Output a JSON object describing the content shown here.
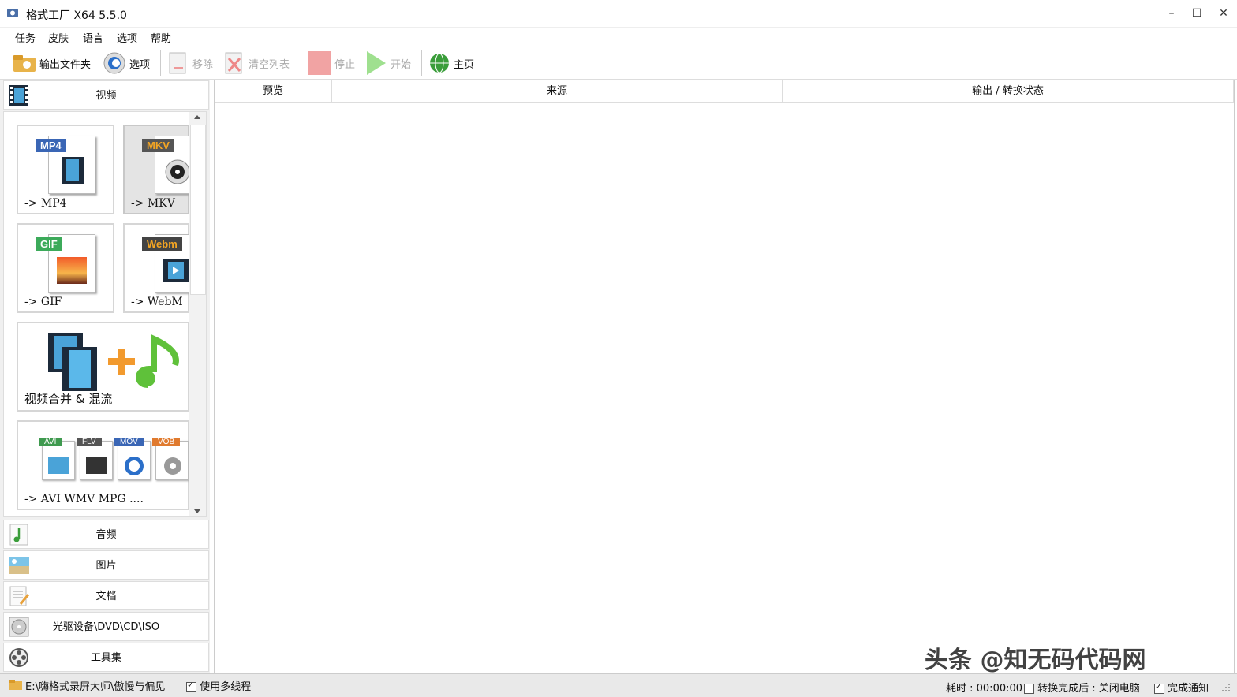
{
  "window": {
    "title": "格式工厂 X64 5.5.0",
    "min": "–",
    "max": "☐",
    "close": "✕"
  },
  "menu": [
    "任务",
    "皮肤",
    "语言",
    "选项",
    "帮助"
  ],
  "toolbar": {
    "output_folder": "输出文件夹",
    "options": "选项",
    "remove": "移除",
    "clear_list": "清空列表",
    "stop": "停止",
    "start": "开始",
    "home": "主页"
  },
  "categories": {
    "video": "视频",
    "audio": "音频",
    "image": "图片",
    "document": "文档",
    "optical": "光驱设备\\DVD\\CD\\ISO",
    "tools": "工具集"
  },
  "tiles": {
    "mp4": {
      "badge": "MP4",
      "caption": "-> MP4",
      "color": "#3a66b5"
    },
    "mkv": {
      "badge": "MKV",
      "caption": "-> MKV",
      "color": "#555555"
    },
    "gif": {
      "badge": "GIF",
      "caption": "-> GIF",
      "color": "#3caa5a"
    },
    "webm": {
      "badge": "Webm",
      "caption": "-> WebM",
      "color": "#444444"
    },
    "merge": {
      "caption": "视频合并 & 混流"
    },
    "multi": {
      "badges": [
        "AVI",
        "FLV",
        "MOV",
        "VOB"
      ],
      "caption": "-> AVI WMV MPG ...."
    }
  },
  "table": {
    "col_preview": "预览",
    "col_source": "来源",
    "col_output": "输出 / 转换状态"
  },
  "status": {
    "path": "E:\\嗨格式录屏大师\\傲慢与偏见",
    "multithread": "使用多线程",
    "multithread_checked": true,
    "elapsed": "耗时 : 00:00:00",
    "after_done": "转换完成后 : 关闭电脑",
    "after_done_checked": false,
    "notify": "完成通知",
    "notify_checked": true
  },
  "watermark": "头条 @知无码代码网"
}
